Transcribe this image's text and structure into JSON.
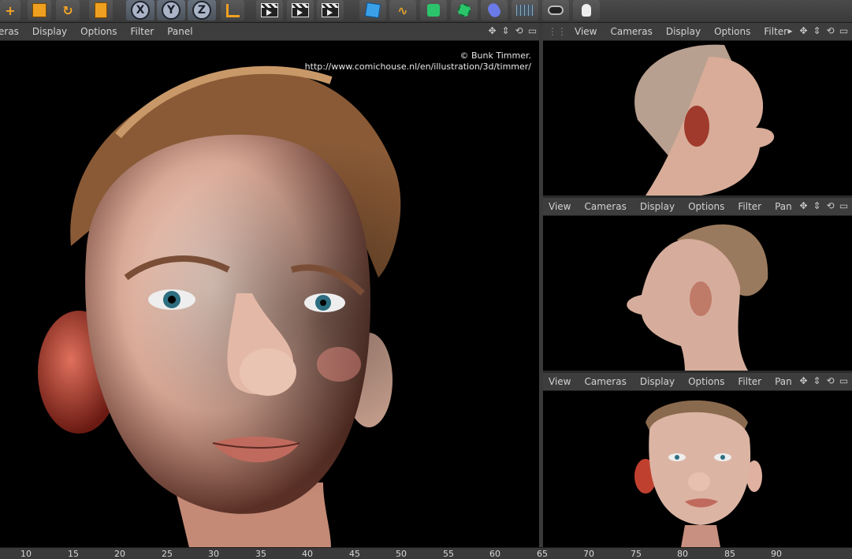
{
  "main_viewport": {
    "menu": [
      "eras",
      "Display",
      "Options",
      "Filter",
      "Panel"
    ],
    "credit_line1": "© Bunk Timmer.",
    "credit_line2": "http://www.comichouse.nl/en/illustration/3d/timmer/"
  },
  "top_right_viewport": {
    "menu": [
      "View",
      "Cameras",
      "Display",
      "Options",
      "Filter"
    ]
  },
  "middle_right_viewport": {
    "menu": [
      "View",
      "Cameras",
      "Display",
      "Options",
      "Filter",
      "Pan"
    ]
  },
  "bottom_right_viewport": {
    "menu": [
      "View",
      "Cameras",
      "Display",
      "Options",
      "Filter",
      "Pan"
    ]
  },
  "toolbar": {
    "axis_x": "X",
    "axis_y": "Y",
    "axis_z": "Z"
  },
  "timeline": {
    "ticks": [
      "10",
      "15",
      "20",
      "25",
      "30",
      "35",
      "40",
      "45",
      "50",
      "55",
      "60",
      "65",
      "70",
      "75",
      "80",
      "85",
      "90"
    ]
  },
  "icons": {
    "nav": [
      "move-icon",
      "zoom-icon",
      "rotate-icon",
      "maximize-icon"
    ]
  },
  "colors": {
    "viewport_bg": "#000000",
    "menubar_bg": "#3d3d3d",
    "axis_button": "#aab4c6"
  }
}
